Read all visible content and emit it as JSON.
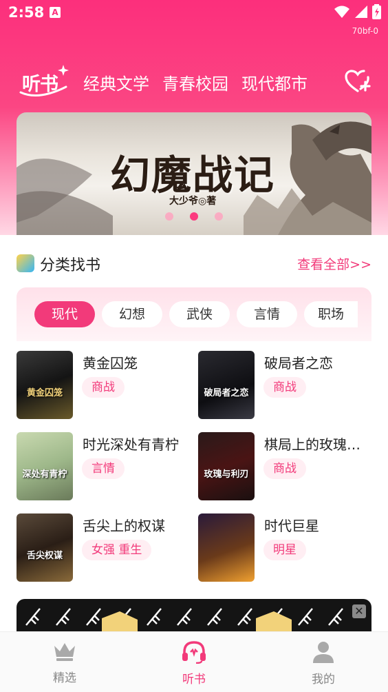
{
  "status": {
    "time": "2:58",
    "notif_glyph": "A",
    "build": "70bf-0"
  },
  "header": {
    "logo_text": "听书",
    "tabs": [
      "经典文学",
      "青春校园",
      "现代都市"
    ]
  },
  "banner": {
    "title": "幻魔战记",
    "author": "大少爷◎著",
    "page_count": 3,
    "active_index": 1
  },
  "section": {
    "title": "分类找书",
    "view_all": "查看全部>>"
  },
  "categories": {
    "items": [
      "现代",
      "幻想",
      "武侠",
      "言情",
      "职场"
    ],
    "active_index": 0
  },
  "books": [
    {
      "title": "黄金囚笼",
      "tag": "商战"
    },
    {
      "title": "破局者之恋",
      "tag": "商战"
    },
    {
      "title": "时光深处有青柠",
      "tag": "言情"
    },
    {
      "title": "棋局上的玫瑰…",
      "tag": "商战"
    },
    {
      "title": "舌尖上的权谋",
      "tag": "女强 重生"
    },
    {
      "title": "时代巨星",
      "tag": "明星"
    }
  ],
  "covers": [
    {
      "text": "黄金囚笼"
    },
    {
      "text": "破局者之恋"
    },
    {
      "text": "深处有青柠"
    },
    {
      "text": "玫瑰与利刃"
    },
    {
      "text": "舌尖权谋"
    },
    {
      "text": ""
    }
  ],
  "ad": {
    "close_glyph": "✕"
  },
  "bottom_nav": [
    {
      "label": "精选",
      "icon": "crown-icon"
    },
    {
      "label": "听书",
      "icon": "headphones-icon"
    },
    {
      "label": "我的",
      "icon": "user-icon"
    }
  ],
  "colors": {
    "accent": "#f23a7a",
    "header_top": "#fc2f7c"
  }
}
